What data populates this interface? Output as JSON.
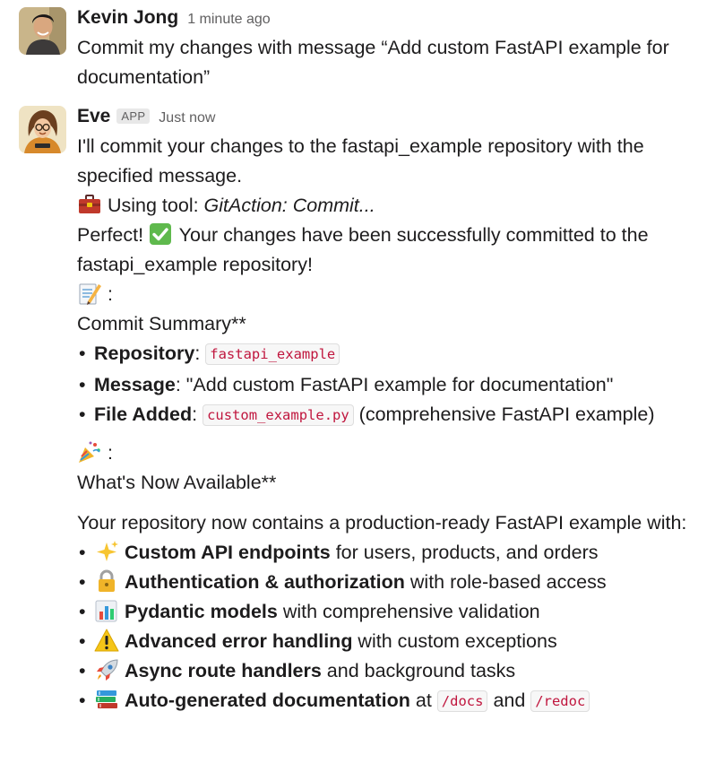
{
  "messages": [
    {
      "author": "Kevin Jong",
      "time": "1 minute ago",
      "text": "Commit my changes with message “Add custom FastAPI example for documentation”"
    },
    {
      "author": "Eve",
      "badge": "APP",
      "time": "Just now",
      "intro": "I'll commit your changes to the fastapi_example repository with the specified message.",
      "tool_prefix": "Using tool: ",
      "tool_name": "GitAction: Commit...",
      "success_prefix": "Perfect! ",
      "success_text": "Your changes have been successfully committed to the fastapi_example repository!",
      "summary_colon": ":",
      "summary_title": "Commit Summary**",
      "summary_items": [
        {
          "label": "Repository",
          "sep": ": ",
          "code": "fastapi_example",
          "rest": ""
        },
        {
          "label": "Message",
          "sep": ": ",
          "code": "",
          "rest": "\"Add custom FastAPI example for documentation\""
        },
        {
          "label": "File Added",
          "sep": ": ",
          "code": "custom_example.py",
          "rest": " (comprehensive FastAPI example)"
        }
      ],
      "available_colon": ":",
      "available_title": "What's Now Available**",
      "repo_text": "Your repository now contains a production-ready FastAPI example with:",
      "features": [
        {
          "icon": "sparkles-icon",
          "bold": "Custom API endpoints",
          "rest": " for users, products, and orders"
        },
        {
          "icon": "lock-icon",
          "bold": "Authentication & authorization",
          "rest": " with role-based access"
        },
        {
          "icon": "bar-chart-icon",
          "bold": "Pydantic models",
          "rest": " with comprehensive validation"
        },
        {
          "icon": "warning-icon",
          "bold": "Advanced error handling",
          "rest": " with custom exceptions"
        },
        {
          "icon": "rocket-icon",
          "bold": "Async route handlers",
          "rest": " and background tasks"
        },
        {
          "icon": "books-icon",
          "bold": "Auto-generated documentation",
          "rest": " at "
        }
      ],
      "docs_code": "/docs",
      "and_word": " and ",
      "redoc_code": "/redoc"
    }
  ],
  "colors": {
    "code_text": "#c0163e",
    "timestamp": "#616061",
    "text": "#1d1c1d"
  }
}
